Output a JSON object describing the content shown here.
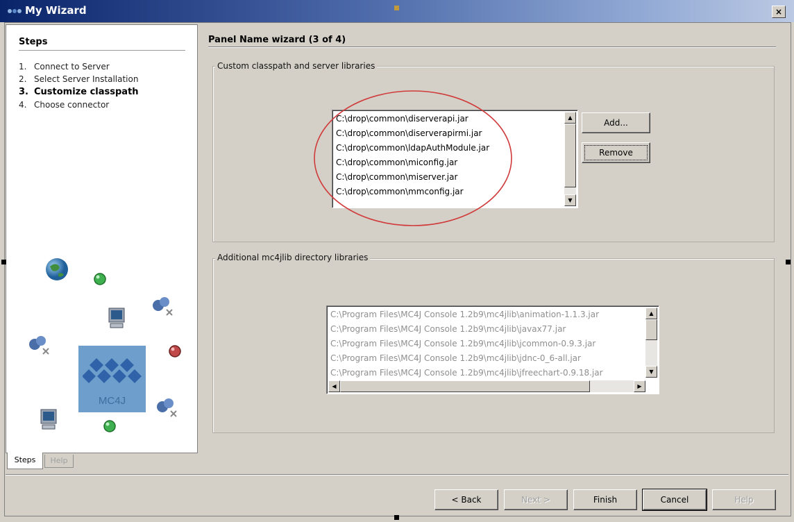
{
  "window": {
    "title": "My Wizard",
    "close_glyph": "×"
  },
  "steps_panel": {
    "heading": "Steps",
    "steps": [
      {
        "number": "1.",
        "label": "Connect to Server",
        "active": false
      },
      {
        "number": "2.",
        "label": "Select Server Installation",
        "active": false
      },
      {
        "number": "3.",
        "label": "Customize classpath",
        "active": true
      },
      {
        "number": "4.",
        "label": "Choose connector",
        "active": false
      }
    ],
    "logo_text": "MC4J",
    "tabs": [
      {
        "label": "Steps",
        "selected": true
      },
      {
        "label": "Help",
        "selected": false
      }
    ]
  },
  "panel": {
    "title": "Panel Name wizard (3 of 4)",
    "custom_group": {
      "label": "Custom classpath and server libraries",
      "items": [
        "C:\\drop\\common\\diserverapi.jar",
        "C:\\drop\\common\\diserverapirmi.jar",
        "C:\\drop\\common\\ldapAuthModule.jar",
        "C:\\drop\\common\\miconfig.jar",
        "C:\\drop\\common\\miserver.jar",
        "C:\\drop\\common\\mmconfig.jar"
      ],
      "add_label": "Add...",
      "remove_label": "Remove",
      "annotation_color": "#d03a3a"
    },
    "additional_group": {
      "label": "Additional mc4jlib directory libraries",
      "items": [
        "C:\\Program Files\\MC4J Console 1.2b9\\mc4jlib\\animation-1.1.3.jar",
        "C:\\Program Files\\MC4J Console 1.2b9\\mc4jlib\\javax77.jar",
        "C:\\Program Files\\MC4J Console 1.2b9\\mc4jlib\\jcommon-0.9.3.jar",
        "C:\\Program Files\\MC4J Console 1.2b9\\mc4jlib\\jdnc-0_6-all.jar",
        "C:\\Program Files\\MC4J Console 1.2b9\\mc4jlib\\jfreechart-0.9.18.jar"
      ]
    }
  },
  "footer": {
    "back_label": "< Back",
    "next_label": "Next >",
    "finish_label": "Finish",
    "cancel_label": "Cancel",
    "help_label": "Help"
  },
  "colors": {
    "titlebar_start": "#0a246a",
    "face": "#d4d0c8",
    "logo_blue": "#6e9ecb"
  }
}
